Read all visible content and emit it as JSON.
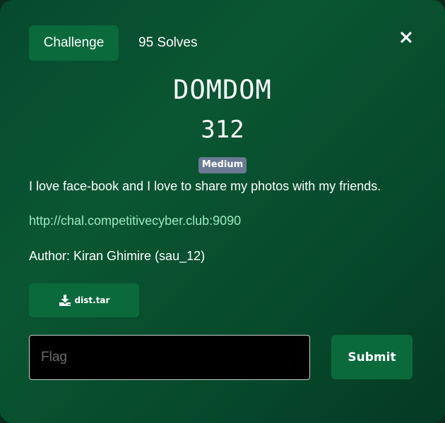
{
  "tabs": {
    "challenge_label": "Challenge",
    "solves_label": "95 Solves"
  },
  "close": {
    "icon": "close-icon"
  },
  "challenge": {
    "name": "DOMDOM",
    "points": "312",
    "difficulty": "Medium",
    "description": "I love face-book and I love to share my photos with my friends.",
    "link": "http://chal.competitivecyber.club:9090",
    "author": "Author: Kiran Ghimire (sau_12)"
  },
  "files": [
    {
      "name": "dist.tar",
      "icon": "download-icon"
    }
  ],
  "submission": {
    "placeholder": "Flag",
    "value": "",
    "submit_label": "Submit"
  },
  "colors": {
    "accent": "#0b6a3c",
    "background": "#0a5632",
    "link": "#9be9c0",
    "badge": "#6b7a93"
  }
}
